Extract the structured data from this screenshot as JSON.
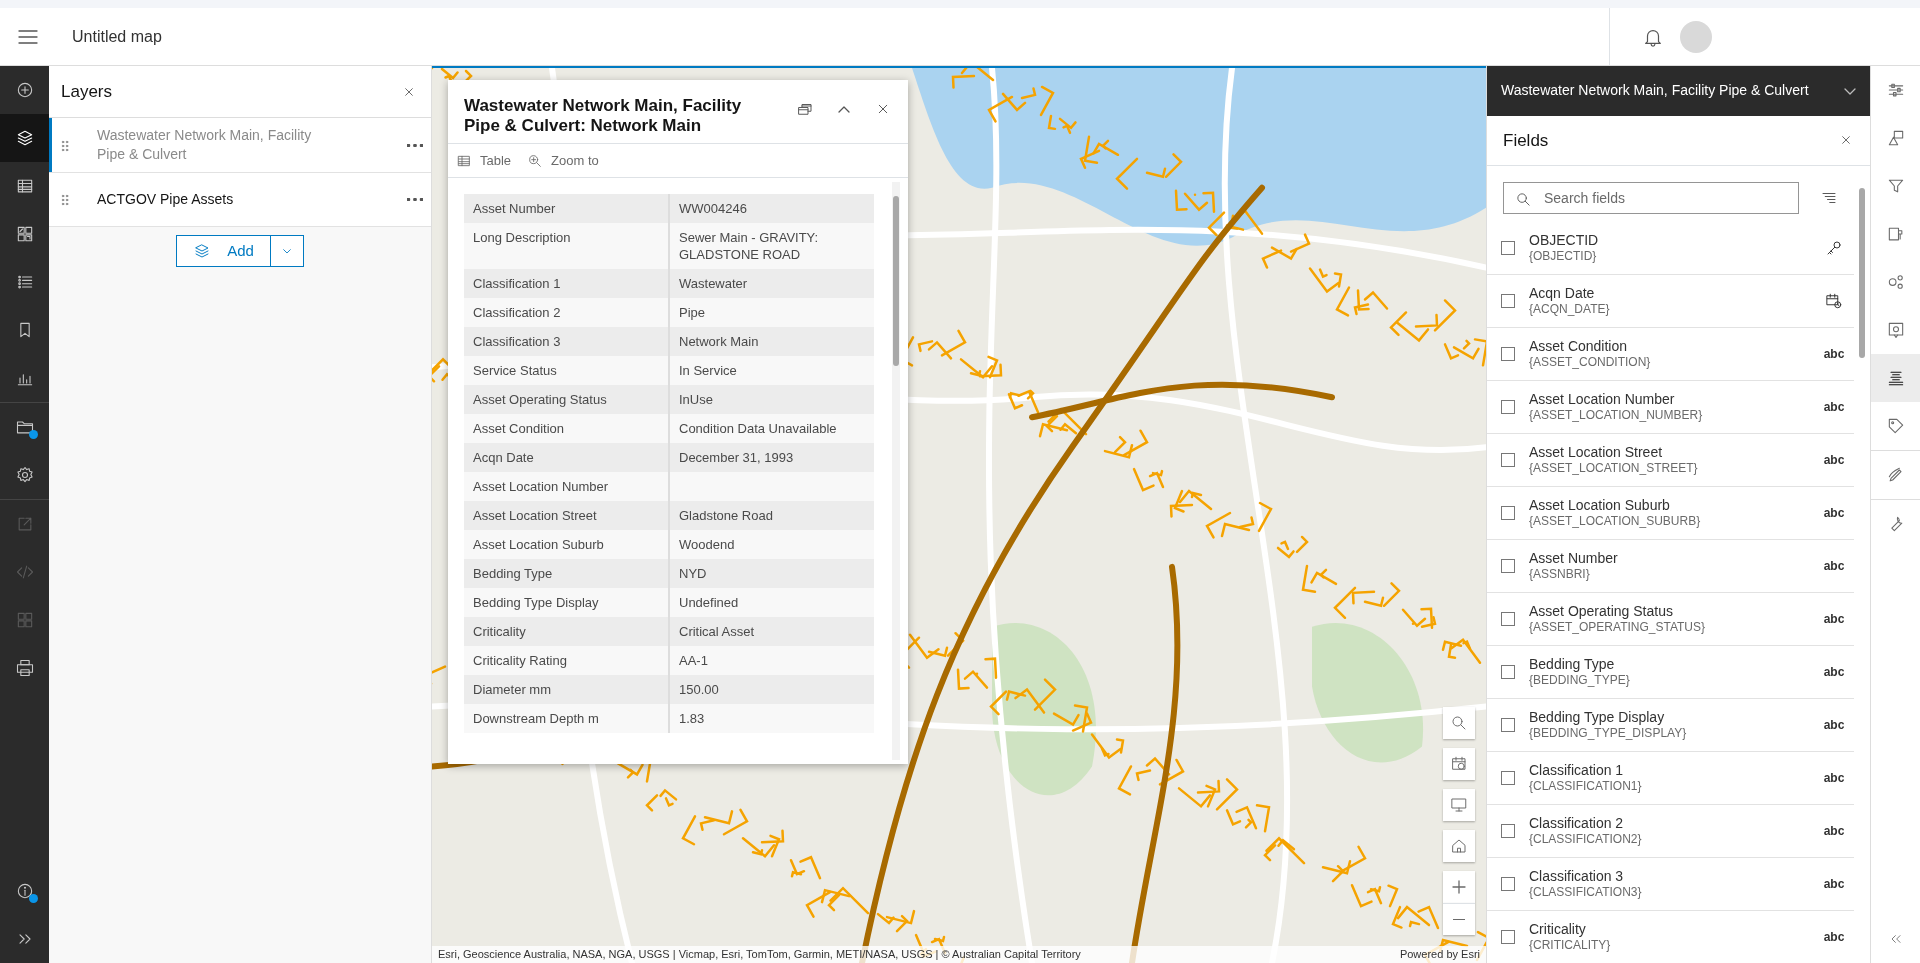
{
  "header": {
    "title": "Untitled map"
  },
  "left_rail": {
    "groups": [
      [
        {
          "selected": false,
          "disabled": false,
          "badge": false
        },
        {
          "selected": true,
          "disabled": false,
          "badge": false
        },
        {
          "selected": false,
          "disabled": false,
          "badge": false
        },
        {
          "selected": false,
          "disabled": false,
          "badge": false
        },
        {
          "selected": false,
          "disabled": false,
          "badge": false
        },
        {
          "selected": false,
          "disabled": false,
          "badge": false
        },
        {
          "selected": false,
          "disabled": false,
          "badge": false
        }
      ],
      [
        {
          "selected": false,
          "disabled": false,
          "badge": true
        },
        {
          "selected": false,
          "disabled": false,
          "badge": false
        }
      ],
      [
        {
          "selected": false,
          "disabled": true,
          "badge": false
        },
        {
          "selected": false,
          "disabled": true,
          "badge": false
        },
        {
          "selected": false,
          "disabled": true,
          "badge": false
        },
        {
          "selected": false,
          "disabled": false,
          "badge": false
        }
      ]
    ],
    "bottom": [
      {
        "selected": false,
        "disabled": false,
        "badge": true
      },
      {
        "selected": false,
        "disabled": false,
        "badge": false
      }
    ]
  },
  "layers_panel": {
    "title": "Layers",
    "layers": [
      {
        "name": "Wastewater Network Main, Facility Pipe & Culvert",
        "selected": true,
        "visible": false
      },
      {
        "name": "ACTGOV Pipe Assets",
        "selected": false,
        "visible": true
      }
    ],
    "add_button": "Add"
  },
  "popup": {
    "title": "Wastewater Network Main, Facility Pipe & Culvert: Network Main",
    "actions": [
      "Table",
      "Zoom to"
    ],
    "rows": [
      {
        "label": "Asset Number",
        "value": "WW004246"
      },
      {
        "label": "Long Description",
        "value": "Sewer Main - GRAVITY: GLADSTONE ROAD"
      },
      {
        "label": "Classification 1",
        "value": "Wastewater"
      },
      {
        "label": "Classification 2",
        "value": "Pipe"
      },
      {
        "label": "Classification 3",
        "value": "Network Main"
      },
      {
        "label": "Service Status",
        "value": "In Service"
      },
      {
        "label": "Asset Operating Status",
        "value": "InUse"
      },
      {
        "label": "Asset Condition",
        "value": "Condition Data Unavailable"
      },
      {
        "label": "Acqn Date",
        "value": "December 31, 1993"
      },
      {
        "label": "Asset Location Number"
      },
      {
        "label": "Asset Location Street",
        "value": "Gladstone Road"
      },
      {
        "label": "Asset Location Suburb",
        "value": "Woodend"
      },
      {
        "label": "Bedding Type",
        "value": "NYD"
      },
      {
        "label": "Bedding Type Display",
        "value": "Undefined"
      },
      {
        "label": "Criticality",
        "value": "Critical Asset"
      },
      {
        "label": "Criticality Rating",
        "value": "AA-1"
      },
      {
        "label": "Diameter mm",
        "value": "150.00"
      },
      {
        "label": "Downstream Depth m",
        "value": "1.83"
      }
    ]
  },
  "map": {
    "attribution": "Esri, Geoscience Australia, NASA, NGA, USGS | Vicmap, Esri, TomTom, Garmin, METI/NASA, USGS | © Australian Capital Territory",
    "powered_by": "Powered by Esri"
  },
  "fields_panel": {
    "layer": "Wastewater Network Main, Facility Pipe & Culvert",
    "title": "Fields",
    "search_placeholder": "Search fields",
    "fields": [
      {
        "name": "OBJECTID",
        "alias": "{OBJECTID}",
        "kind": "key",
        "checked": false
      },
      {
        "name": "Acqn Date",
        "alias": "{ACQN_DATE}",
        "kind": "date",
        "checked": false
      },
      {
        "name": "Asset Condition",
        "alias": "{ASSET_CONDITION}",
        "kind": "text",
        "type_label": "abc",
        "checked": false
      },
      {
        "name": "Asset Location Number",
        "alias": "{ASSET_LOCATION_NUMBER}",
        "kind": "text",
        "type_label": "abc",
        "checked": false
      },
      {
        "name": "Asset Location Street",
        "alias": "{ASSET_LOCATION_STREET}",
        "kind": "text",
        "type_label": "abc",
        "checked": false
      },
      {
        "name": "Asset Location Suburb",
        "alias": "{ASSET_LOCATION_SUBURB}",
        "kind": "text",
        "type_label": "abc",
        "checked": false
      },
      {
        "name": "Asset Number",
        "alias": "{ASSNBRI}",
        "kind": "text",
        "type_label": "abc",
        "checked": false
      },
      {
        "name": "Asset Operating Status",
        "alias": "{ASSET_OPERATING_STATUS}",
        "kind": "text",
        "type_label": "abc",
        "checked": false
      },
      {
        "name": "Bedding Type",
        "alias": "{BEDDING_TYPE}",
        "kind": "text",
        "type_label": "abc",
        "checked": false
      },
      {
        "name": "Bedding Type Display",
        "alias": "{BEDDING_TYPE_DISPLAY}",
        "kind": "text",
        "type_label": "abc",
        "checked": false
      },
      {
        "name": "Classification 1",
        "alias": "{CLASSIFICATION1}",
        "kind": "text",
        "type_label": "abc",
        "checked": false
      },
      {
        "name": "Classification 2",
        "alias": "{CLASSIFICATION2}",
        "kind": "text",
        "type_label": "abc",
        "checked": false
      },
      {
        "name": "Classification 3",
        "alias": "{CLASSIFICATION3}",
        "kind": "text",
        "type_label": "abc",
        "checked": false
      },
      {
        "name": "Criticality",
        "alias": "{CRITICALITY}",
        "kind": "text",
        "type_label": "abc",
        "checked": false
      }
    ]
  },
  "right_rail": {
    "groups": [
      [
        {
          "selected": false
        },
        {
          "selected": false
        },
        {
          "selected": false
        },
        {
          "selected": false
        },
        {
          "selected": false
        },
        {
          "selected": false
        },
        {
          "selected": true
        },
        {
          "selected": false
        }
      ],
      [
        {
          "selected": false
        }
      ],
      [
        {
          "selected": false
        }
      ]
    ]
  }
}
